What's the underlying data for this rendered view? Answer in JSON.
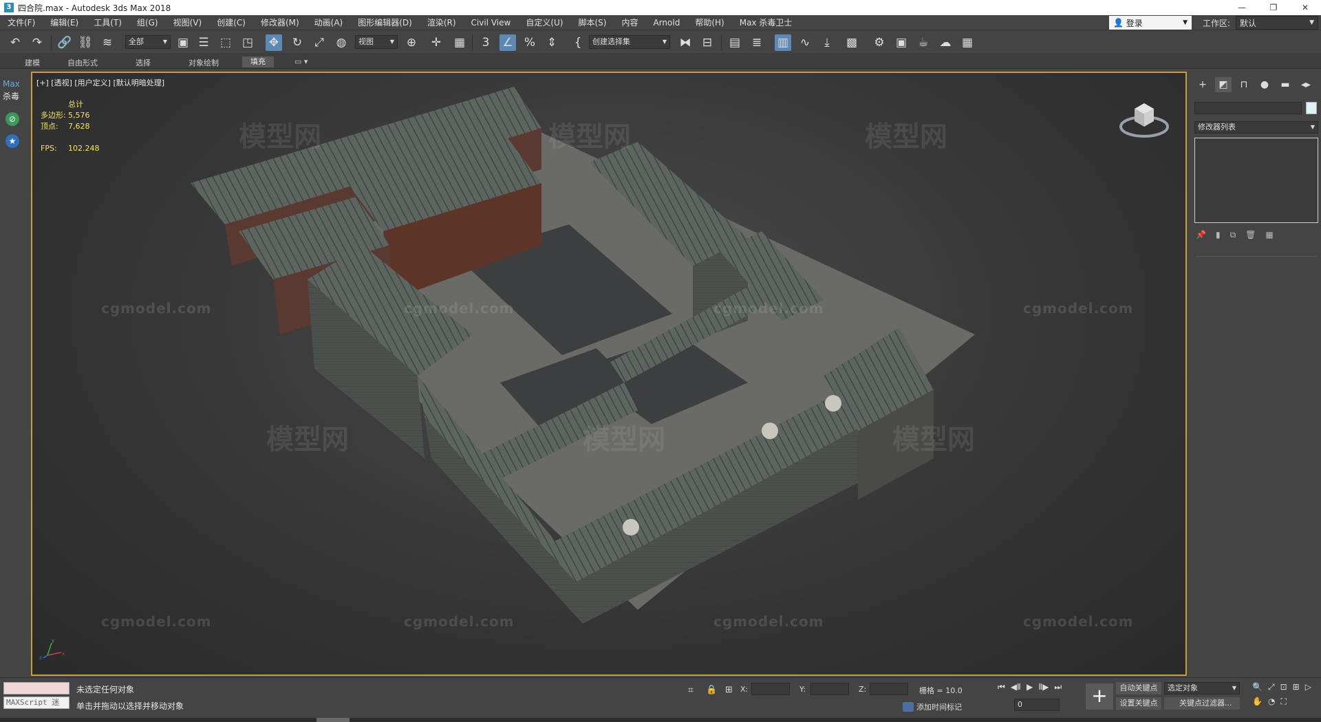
{
  "window": {
    "title": "四合院.max - Autodesk 3ds Max 2018",
    "app_icon": "3"
  },
  "menubar": {
    "items": [
      "文件(F)",
      "编辑(E)",
      "工具(T)",
      "组(G)",
      "视图(V)",
      "创建(C)",
      "修改器(M)",
      "动画(A)",
      "图形编辑器(D)",
      "渲染(R)",
      "Civil View",
      "自定义(U)",
      "脚本(S)",
      "内容",
      "Arnold",
      "帮助(H)",
      "Max 杀毒卫士"
    ],
    "login": "登录",
    "workspace_label": "工作区:",
    "workspace_value": "默认"
  },
  "toolbar": {
    "selection_filter": "全部",
    "ref_coord": "视图",
    "named_selection": "创建选择集"
  },
  "ribbon": {
    "tabs": [
      "建模",
      "自由形式",
      "选择",
      "对象绘制",
      "填充"
    ],
    "active_tab": "填充"
  },
  "leftbar": {
    "max_label": "Max",
    "antivirus_label": "杀毒"
  },
  "viewport": {
    "label": "[+] [透视] [用户定义] [默认明暗处理]",
    "stats": {
      "total_label": "总计",
      "polys_label": "多边形:",
      "polys_value": "5,576",
      "verts_label": "顶点:",
      "verts_value": "7,628",
      "fps_label": "FPS:",
      "fps_value": "102.248"
    },
    "watermark_text": "模型网",
    "watermark_url": "cgmodel.com",
    "axis": {
      "x": "x",
      "y": "y",
      "z": "z"
    }
  },
  "command_panel": {
    "modifier_list": "修改器列表",
    "swatch_color": "#dff3f6"
  },
  "statusbar": {
    "maxscript_placeholder": "MAXScript 迷",
    "status": "未选定任何对象",
    "prompt": "单击并拖动以选择并移动对象",
    "x_label": "X:",
    "y_label": "Y:",
    "z_label": "Z:",
    "grid": "栅格 = 10.0",
    "add_time_tag": "添加时间标记",
    "frame": "0",
    "auto_key": "自动关键点",
    "set_key": "设置关键点",
    "selected_object": "选定对象",
    "key_filters": "关键点过滤器..."
  }
}
